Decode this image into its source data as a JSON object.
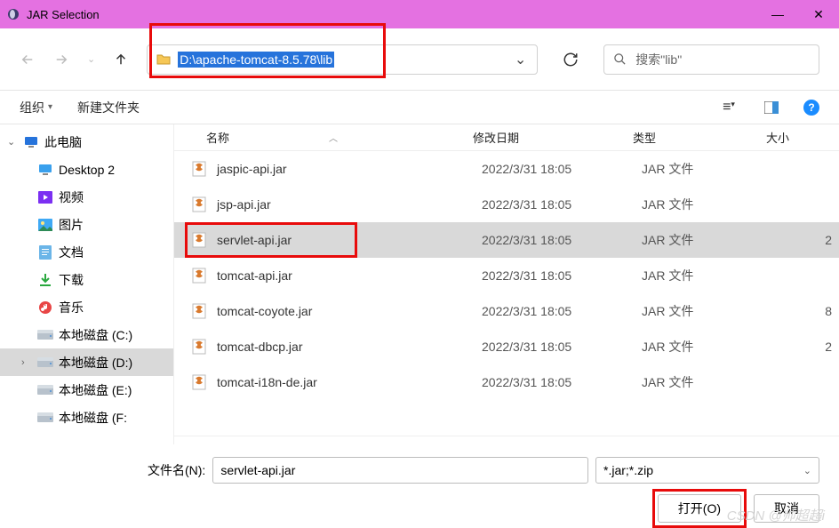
{
  "window": {
    "title": "JAR Selection"
  },
  "nav": {
    "path": "D:\\apache-tomcat-8.5.78\\lib",
    "search_placeholder": "搜索\"lib\""
  },
  "toolbar": {
    "organize": "组织",
    "newfolder": "新建文件夹"
  },
  "sidebar": {
    "root": "此电脑",
    "items": [
      {
        "label": "Desktop 2",
        "icon": "desktop"
      },
      {
        "label": "视频",
        "icon": "video"
      },
      {
        "label": "图片",
        "icon": "picture"
      },
      {
        "label": "文档",
        "icon": "document"
      },
      {
        "label": "下载",
        "icon": "download"
      },
      {
        "label": "音乐",
        "icon": "music"
      },
      {
        "label": "本地磁盘 (C:)",
        "icon": "drive"
      },
      {
        "label": "本地磁盘 (D:)",
        "icon": "drive",
        "selected": true
      },
      {
        "label": "本地磁盘 (E:)",
        "icon": "drive"
      },
      {
        "label": "本地磁盘 (F:)",
        "icon": "drive",
        "cut": true
      }
    ]
  },
  "columns": {
    "name": "名称",
    "date": "修改日期",
    "type": "类型",
    "size": "大小"
  },
  "files": [
    {
      "name": "jaspic-api.jar",
      "date": "2022/3/31 18:05",
      "type": "JAR 文件",
      "size": ""
    },
    {
      "name": "jsp-api.jar",
      "date": "2022/3/31 18:05",
      "type": "JAR 文件",
      "size": ""
    },
    {
      "name": "servlet-api.jar",
      "date": "2022/3/31 18:05",
      "type": "JAR 文件",
      "size": "2",
      "selected": true
    },
    {
      "name": "tomcat-api.jar",
      "date": "2022/3/31 18:05",
      "type": "JAR 文件",
      "size": ""
    },
    {
      "name": "tomcat-coyote.jar",
      "date": "2022/3/31 18:05",
      "type": "JAR 文件",
      "size": "8"
    },
    {
      "name": "tomcat-dbcp.jar",
      "date": "2022/3/31 18:05",
      "type": "JAR 文件",
      "size": "2"
    },
    {
      "name": "tomcat-i18n-de.jar",
      "date": "2022/3/31 18:05",
      "type": "JAR 文件",
      "size": ""
    }
  ],
  "footer": {
    "filename_label": "文件名(N):",
    "filename_value": "servlet-api.jar",
    "filter": "*.jar;*.zip",
    "open": "打开(O)",
    "cancel": "取消"
  },
  "watermark": "CSDN @帅超超i"
}
